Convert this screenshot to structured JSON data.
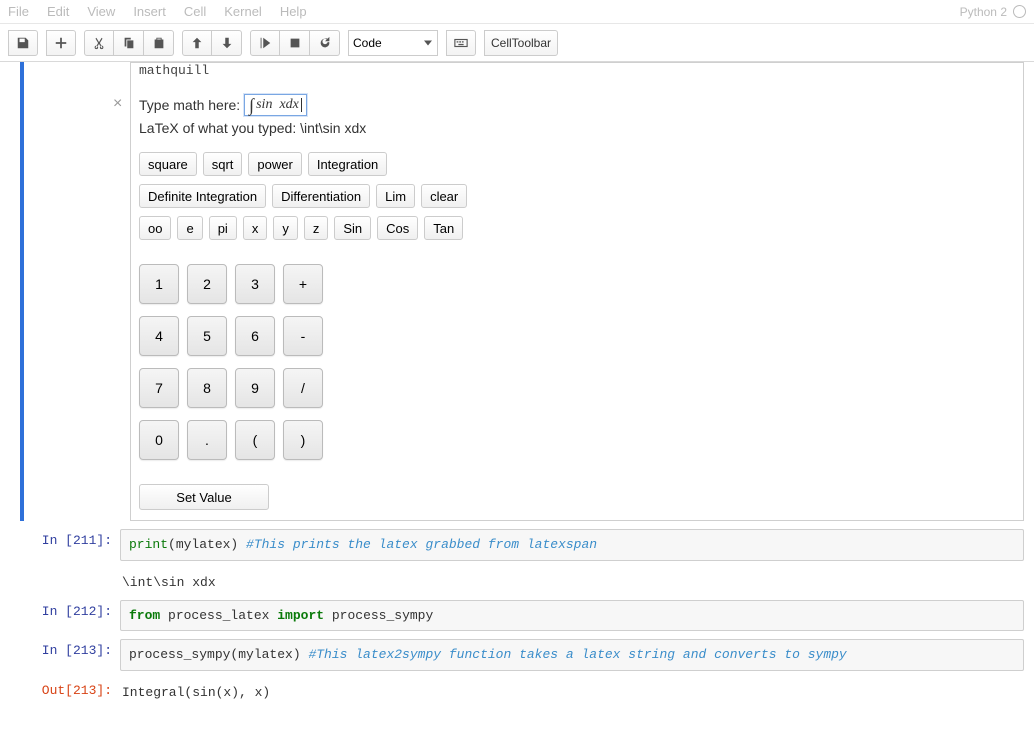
{
  "menu": {
    "items": [
      "File",
      "Edit",
      "View",
      "Insert",
      "Cell",
      "Kernel",
      "Help"
    ],
    "kernel": "Python 2"
  },
  "toolbar": {
    "cellTypeSelected": "Code",
    "cellToolbarLabel": "CellToolbar"
  },
  "widget": {
    "monolabel": "mathquill",
    "typePrompt": "Type math here:",
    "mathDisplay": "∫ sin xdx",
    "latexLabel": "LaTeX of what you typed: ",
    "latexValue": "\\int\\sin xdx",
    "row1": [
      "square",
      "sqrt",
      "power",
      "Integration"
    ],
    "row2": [
      "Definite Integration",
      "Differentiation",
      "Lim",
      "clear"
    ],
    "row3": [
      "oo",
      "e",
      "pi",
      "x",
      "y",
      "z",
      "Sin",
      "Cos",
      "Tan"
    ],
    "keypad": [
      [
        "1",
        "2",
        "3",
        "+"
      ],
      [
        "4",
        "5",
        "6",
        "-"
      ],
      [
        "7",
        "8",
        "9",
        "/"
      ],
      [
        "0",
        ".",
        "(",
        ")"
      ]
    ],
    "setValue": "Set Value"
  },
  "cells": [
    {
      "inPrompt": "In [211]:",
      "codePlain1": "print",
      "codePlain2": "(mylatex) ",
      "comment": "#This prints the latex grabbed from latexspan",
      "output": "\\int\\sin xdx"
    },
    {
      "inPrompt": "In [212]:",
      "kw1": "from",
      "mod": " process_latex ",
      "kw2": "import",
      "imp": " process_sympy"
    },
    {
      "inPrompt": "In [213]:",
      "call": "process_sympy(mylatex) ",
      "comment": "#This latex2sympy function takes a latex string and converts to sympy",
      "outPrompt": "Out[213]:",
      "output": "Integral(sin(x), x)"
    }
  ]
}
